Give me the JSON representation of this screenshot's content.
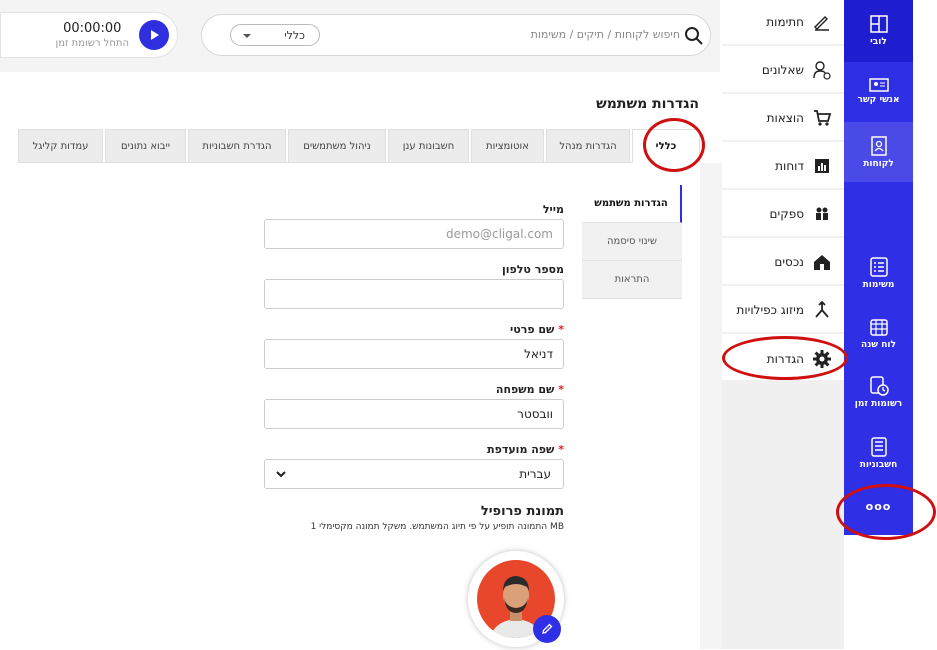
{
  "timer": {
    "time": "00:00:00",
    "subtitle": "התחל רשומת זמן"
  },
  "search": {
    "placeholder": "חיפוש לקוחות / תיקים / משימות",
    "scope": "כללי"
  },
  "bluebar": {
    "items": [
      {
        "label": "לובי",
        "icon": "layout-icon"
      },
      {
        "label": "אנשי קשר",
        "icon": "contact-card-icon"
      },
      {
        "label": "לקוחות",
        "icon": "client-card-icon"
      },
      {
        "label": "משימות",
        "icon": "checklist-icon"
      },
      {
        "label": "לוח שנה",
        "icon": "calendar-icon"
      },
      {
        "label": "רשומות זמן",
        "icon": "time-records-icon"
      },
      {
        "label": "חשבוניות",
        "icon": "invoice-icon"
      }
    ],
    "more": "ooo"
  },
  "sidemenu": {
    "items": [
      {
        "label": "חתימות",
        "icon": "signature-icon"
      },
      {
        "label": "שאלונים",
        "icon": "questionnaire-icon"
      },
      {
        "label": "הוצאות",
        "icon": "cart-icon"
      },
      {
        "label": "דוחות",
        "icon": "report-icon"
      },
      {
        "label": "ספקים",
        "icon": "suppliers-icon"
      },
      {
        "label": "נכסים",
        "icon": "property-icon"
      },
      {
        "label": "מיזוג כפילויות",
        "icon": "merge-icon"
      },
      {
        "label": "הגדרות",
        "icon": "gear-icon"
      }
    ]
  },
  "page": {
    "title": "הגדרות משתמש"
  },
  "tabs": [
    "כללי",
    "הגדרות מנהל",
    "אוטומציות",
    "חשבונות ענן",
    "ניהול משתמשים",
    "הגדרת חשבוניות",
    "ייבוא נתונים",
    "עמדות קליגל"
  ],
  "subnav": [
    "הגדרות משתמש",
    "שינוי סיסמה",
    "התראות"
  ],
  "form": {
    "email": {
      "label": "מייל",
      "placeholder": "demo@cligal.com"
    },
    "phone": {
      "label": "מספר טלפון",
      "value": ""
    },
    "first_name": {
      "label": "שם פרטי",
      "value": "דניאל",
      "required": "*"
    },
    "last_name": {
      "label": "שם משפחה",
      "value": "וובסטר",
      "required": "*"
    },
    "language": {
      "label": "שפה מועדפת",
      "value": "עברית",
      "required": "*"
    },
    "profile": {
      "title": "תמונת פרופיל",
      "note": "התמונה תופיע על פי תיוג המשתמש. משקל תמונה מקסימלי 1 MB"
    }
  },
  "colors": {
    "accent": "#2f2fe6",
    "annotation": "#d01010"
  }
}
